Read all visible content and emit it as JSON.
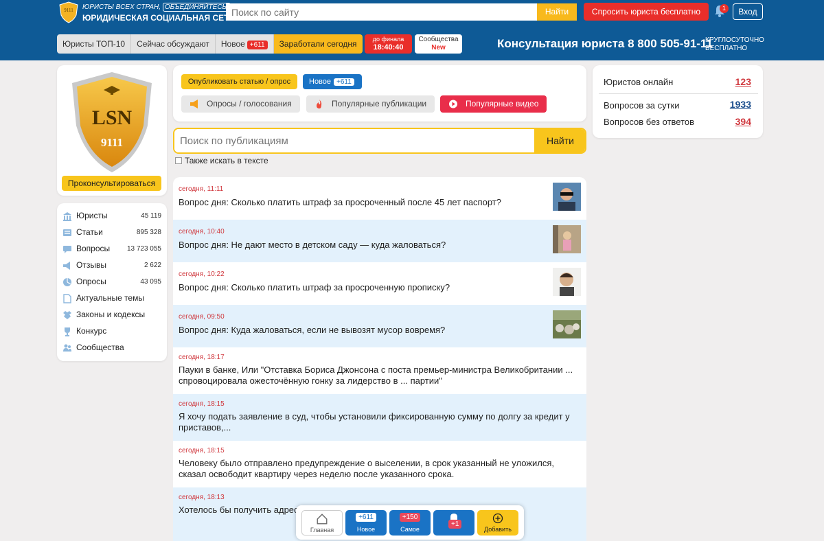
{
  "header": {
    "logo_text": "9111",
    "slogan_prefix": "ЮРИСТЫ ВСЕХ СТРАН,",
    "slogan_highlight": "ОБЪЕДИНЯЙТЕСЬ!",
    "site_name": "ЮРИДИЧЕСКАЯ СОЦИАЛЬНАЯ СЕТЬ",
    "search_placeholder": "Поиск по сайту",
    "search_button": "Найти",
    "ask_button": "Спросить юриста бесплатно",
    "bell_count": "1",
    "login_button": "Вход"
  },
  "nav": {
    "tabs": [
      {
        "label": "Юристы ТОП-10"
      },
      {
        "label": "Сейчас обсуждают"
      },
      {
        "label": "Новое",
        "badge": "+611"
      },
      {
        "label": "Заработали сегодня"
      }
    ],
    "final_label": "до финала",
    "final_timer": "18:40:40",
    "communities_label": "Сообщества",
    "communities_badge": "New",
    "phone": "Консультация юриста 8 800 505-91-11",
    "phone_sub1": "КРУГЛОСУТОЧНО",
    "phone_sub2": "БЕСПЛАТНО"
  },
  "left": {
    "logo_main": "LSN",
    "logo_number": "9111",
    "consult_button": "Проконсультироваться",
    "menu": [
      {
        "label": "Юристы",
        "count": "45 119",
        "icon": "building-icon"
      },
      {
        "label": "Статьи",
        "count": "895 328",
        "icon": "articles-icon"
      },
      {
        "label": "Вопросы",
        "count": "13 723 055",
        "icon": "chat-icon"
      },
      {
        "label": "Отзывы",
        "count": "2 622",
        "icon": "megaphone-icon"
      },
      {
        "label": "Опросы",
        "count": "43 095",
        "icon": "pie-chart-icon"
      },
      {
        "label": "Актуальные темы",
        "count": "",
        "icon": "document-icon"
      },
      {
        "label": "Законы и кодексы",
        "count": "",
        "icon": "eagle-icon"
      },
      {
        "label": "Конкурс",
        "count": "",
        "icon": "trophy-icon"
      },
      {
        "label": "Сообщества",
        "count": "",
        "icon": "users-icon"
      }
    ]
  },
  "center": {
    "publish_button": "Опубликовать статью / опрос",
    "new_button": "Новое",
    "new_count": "+611",
    "polls_button": "Опросы / голосования",
    "popular_button": "Популярные публикации",
    "video_button": "Популярные видео",
    "search_placeholder": "Поиск по публикациям",
    "search_button": "Найти",
    "also_search": "Также искать в тексте",
    "posts": [
      {
        "time": "сегодня, 11:11",
        "title": "Вопрос дня: Сколько платить штраф за просроченный после 45 лет паспорт?",
        "thumb": "man-glasses"
      },
      {
        "time": "сегодня, 10:40",
        "title": "Вопрос дня: Не дают место в детском саду — куда жаловаться?",
        "thumb": "child"
      },
      {
        "time": "сегодня, 10:22",
        "title": "Вопрос дня: Сколько платить штраф за просроченную прописку?",
        "thumb": "worried-man"
      },
      {
        "time": "сегодня, 09:50",
        "title": "Вопрос дня: Куда жаловаться, если не вывозят мусор вовремя?",
        "thumb": "garbage"
      },
      {
        "time": "сегодня, 18:17",
        "title": "Пауки в банке, Или \"Отставка Бориса Джонсона с поста премьер-министра Великобритании ... спровоцировала ожесточённую гонку за лидерство в ... партии\""
      },
      {
        "time": "сегодня, 18:15",
        "title": "Я хочу подать заявление в суд, чтобы установили фиксированную сумму по долгу за кредит у приставов,..."
      },
      {
        "time": "сегодня, 18:15",
        "title": "Человеку было отправлено предупреждение о выселении, в срок указанный не уложился, сказал освободит квартиру через неделю после указанного срока."
      },
      {
        "time": "сегодня, 18:13",
        "title": "Хотелось бы получить адрес ... й ... исьменно обратиться осуждённый дл... ибо."
      }
    ]
  },
  "right": {
    "stats": [
      {
        "label": "Юристов онлайн",
        "value": "123",
        "color": "#d0383e"
      },
      {
        "label": "Вопросов за сутки",
        "value": "1933",
        "color": "#1a4d8c"
      },
      {
        "label": "Вопросов без ответов",
        "value": "394",
        "color": "#d0383e"
      }
    ]
  },
  "bottombar": {
    "home": "Главная",
    "new_count": "+611",
    "new_label": "Новое",
    "top_count": "+150",
    "top_label": "Самое",
    "bell_count": "+1",
    "add_label": "Добавить"
  },
  "colors": {
    "header_blue": "#0e5a96",
    "accent_yellow": "#f8c51c",
    "accent_red": "#e92e2a",
    "link_blue": "#1a73c5",
    "alt_row": "#e3f1fc"
  }
}
